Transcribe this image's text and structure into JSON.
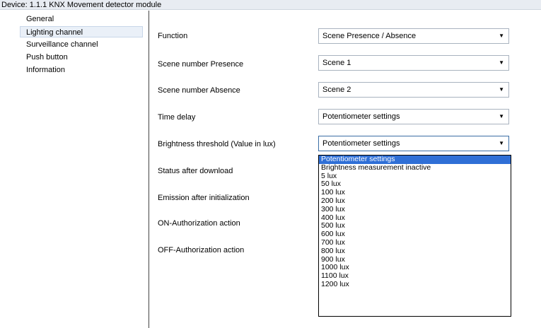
{
  "window": {
    "title": "Device: 1.1.1  KNX Movement detector module"
  },
  "sidebar": {
    "items": [
      {
        "label": "General"
      },
      {
        "label": "Lighting channel"
      },
      {
        "label": "Surveillance channel"
      },
      {
        "label": "Push button"
      },
      {
        "label": "Information"
      }
    ],
    "selected": "Lighting channel"
  },
  "params": {
    "rows": [
      {
        "label": "Function",
        "value": "Scene Presence / Absence"
      },
      {
        "label": "Scene number Presence",
        "value": "Scene 1"
      },
      {
        "label": "Scene number Absence",
        "value": "Scene 2"
      },
      {
        "label": "Time delay",
        "value": "Potentiometer settings"
      },
      {
        "label": "Brightness threshold (Value in lux)",
        "value": "Potentiometer settings"
      },
      {
        "label": "Status after download"
      },
      {
        "label": "Emission after initialization"
      },
      {
        "label": "ON-Authorization action"
      },
      {
        "label": "OFF-Authorization action"
      }
    ]
  },
  "dropdown": {
    "selected": "Potentiometer settings",
    "options": [
      "Potentiometer settings",
      "Brightness measurement inactive",
      "5 lux",
      "50 lux",
      "100 lux",
      "200 lux",
      "300 lux",
      "400 lux",
      "500 lux",
      "600 lux",
      "700 lux",
      "800 lux",
      "900 lux",
      "1000 lux",
      "1100 lux",
      "1200 lux"
    ]
  },
  "colors": {
    "selection": "#2f6fd6",
    "titlebar_bg": "#e8ecf2",
    "sidebar_selected_bg": "#eaf0f8"
  }
}
